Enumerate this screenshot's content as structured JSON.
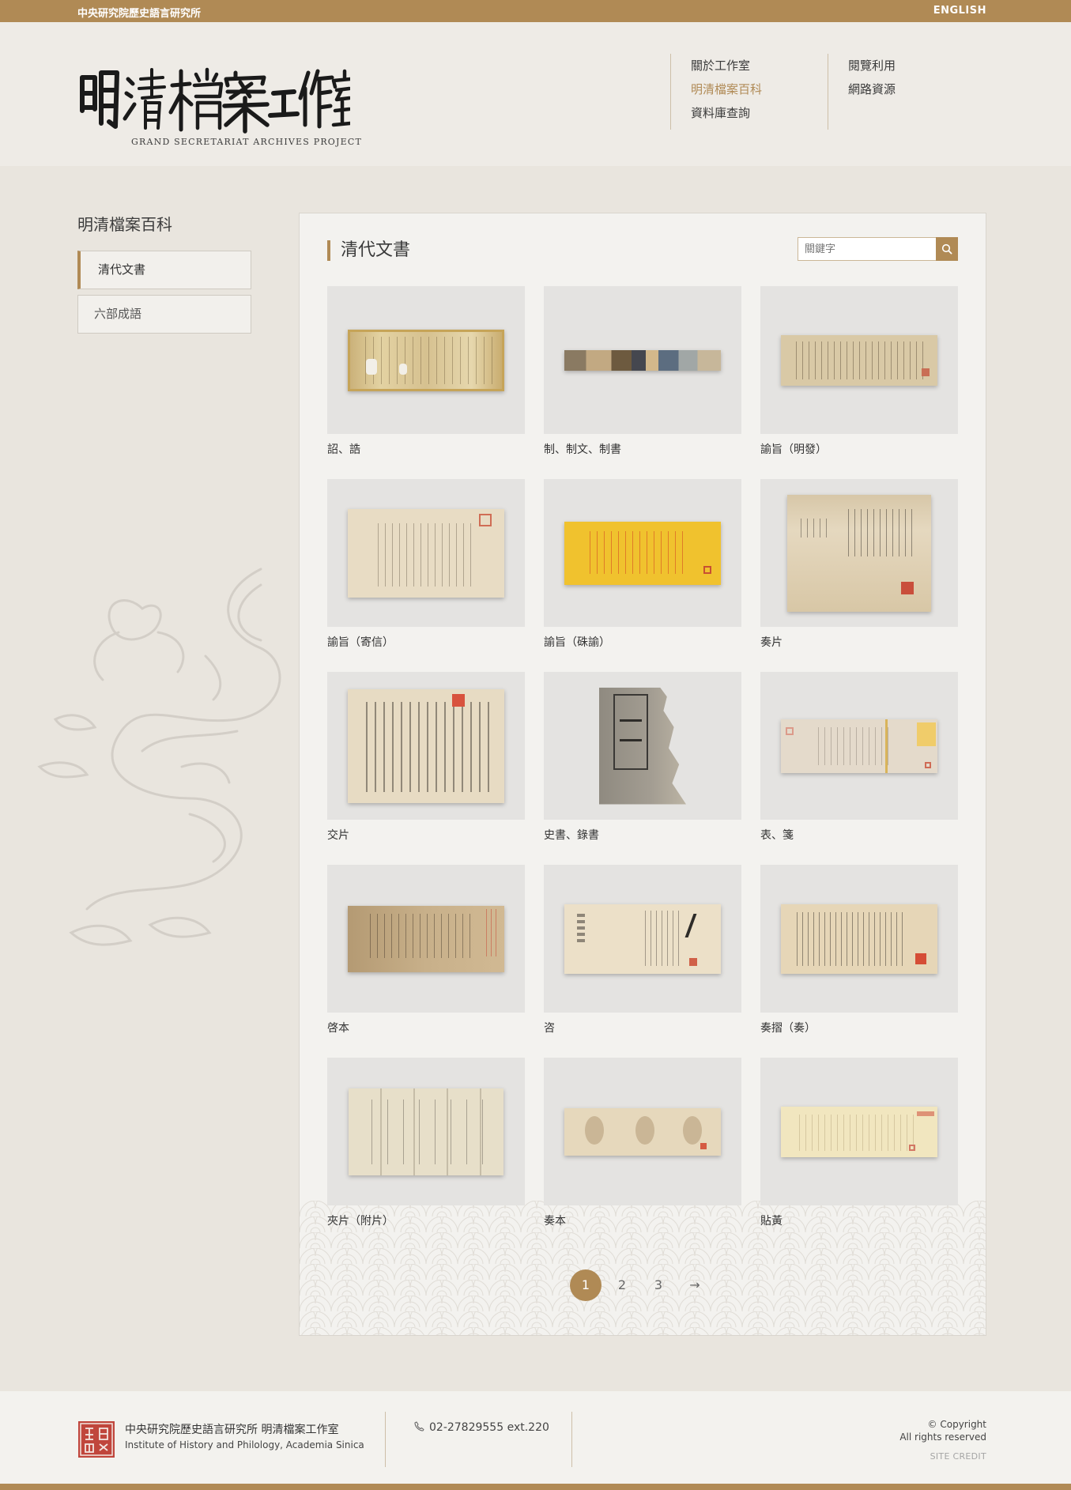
{
  "topbar": {
    "institute": "中央研究院歷史語言研究所",
    "language": "ENGLISH"
  },
  "header": {
    "logo_text": "明清檔案工作室",
    "logo_subtitle": "GRAND SECRETARIAT ARCHIVES PROJECT",
    "nav": [
      {
        "label": "關於工作室"
      },
      {
        "label": "明清檔案百科"
      },
      {
        "label": "資料庫查詢"
      },
      {
        "label": "閱覽利用"
      },
      {
        "label": "網路資源"
      }
    ]
  },
  "sidebar": {
    "title": "明清檔案百科",
    "items": [
      {
        "label": "清代文書"
      },
      {
        "label": "六部成語"
      }
    ]
  },
  "main": {
    "title": "清代文書",
    "search_placeholder": "關鍵字",
    "items": [
      {
        "label": "詔、誥"
      },
      {
        "label": "制、制文、制書"
      },
      {
        "label": "諭旨（明發）"
      },
      {
        "label": "諭旨（寄信）"
      },
      {
        "label": "諭旨（硃諭）"
      },
      {
        "label": "奏片"
      },
      {
        "label": "交片"
      },
      {
        "label": "史書、錄書"
      },
      {
        "label": "表、箋"
      },
      {
        "label": "啓本"
      },
      {
        "label": "咨"
      },
      {
        "label": "奏摺（奏）"
      },
      {
        "label": "夾片（附片）"
      },
      {
        "label": "奏本"
      },
      {
        "label": "貼黃"
      }
    ],
    "pagination": {
      "pages": [
        "1",
        "2",
        "3"
      ],
      "next": "→",
      "current": "1"
    }
  },
  "footer": {
    "institute_name": "中央研究院歷史語言研究所 明清檔案工作室",
    "institute_en": "Institute of History and Philology, Academia Sinica",
    "phone": "02-27829555 ext.220",
    "copyright": "© Copyright",
    "rights": "All rights reserved",
    "credit": "SITE CREDIT"
  },
  "colors": {
    "accent": "#b08a55",
    "background": "#ebe7e1",
    "thumb_bg": "#e4e3e1"
  }
}
